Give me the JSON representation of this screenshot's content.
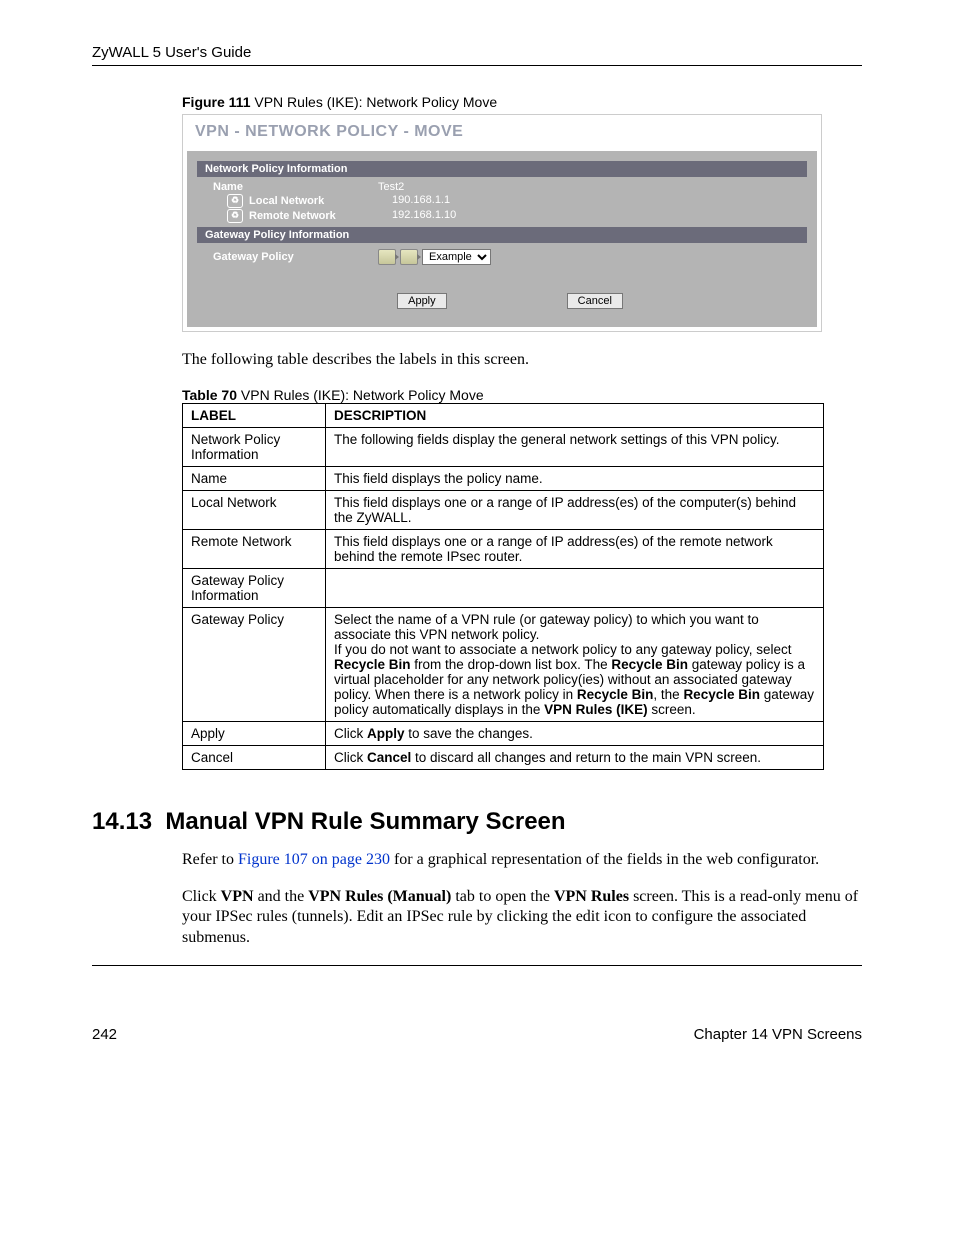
{
  "header": "ZyWALL 5 User's Guide",
  "figure_caption_bold": "Figure 111",
  "figure_caption_rest": "   VPN Rules (IKE): Network Policy Move",
  "panel": {
    "title": "VPN - NETWORK POLICY - MOVE",
    "band1": "Network Policy Information",
    "name_label": "Name",
    "name_value": "Test2",
    "local_label": "Local Network",
    "local_value": "190.168.1.1",
    "remote_label": "Remote Network",
    "remote_value": "192.168.1.10",
    "band2": "Gateway Policy Information",
    "gw_label": "Gateway Policy",
    "gw_select_value": "Example",
    "apply": "Apply",
    "cancel": "Cancel"
  },
  "intro_para": "The following table describes the labels in this screen.",
  "table_caption_bold": "Table 70",
  "table_caption_rest": "   VPN Rules (IKE): Network Policy Move",
  "th_label": "LABEL",
  "th_desc": "DESCRIPTION",
  "rows": [
    {
      "label": "Network Policy Information",
      "desc": "The following fields display the general network settings of this VPN policy."
    },
    {
      "label": "Name",
      "desc": "This field displays the policy name."
    },
    {
      "label": "Local Network",
      "desc": "This field displays one or a range of IP address(es) of the computer(s) behind the ZyWALL."
    },
    {
      "label": "Remote Network",
      "desc": "This field displays one or a range of IP address(es) of the remote network behind the remote IPsec router."
    },
    {
      "label": "Gateway Policy Information",
      "desc": ""
    },
    {
      "label": "Gateway Policy",
      "desc_html": "Select the name of a VPN rule (or gateway policy) to which you want to associate this VPN network policy.<br>If you do not want to associate a network policy to any gateway policy, select <b>Recycle Bin</b> from the drop-down list box. The <b>Recycle Bin</b> gateway policy is a virtual placeholder for any network policy(ies) without an associated gateway policy. When there is a network policy in <b>Recycle Bin</b>, the <b>Recycle Bin</b> gateway policy automatically displays in the <b>VPN Rules (IKE)</b> screen."
    },
    {
      "label": "Apply",
      "desc_html": "Click <b>Apply</b> to save the changes."
    },
    {
      "label": "Cancel",
      "desc_html": "Click <b>Cancel</b> to discard all changes and return to the main VPN screen."
    }
  ],
  "section_number": "14.13",
  "section_title": "Manual VPN Rule Summary Screen",
  "section_para1_pre": "Refer to ",
  "section_para1_link": "Figure 107 on page 230",
  "section_para1_post": " for a graphical representation of the fields in the web configurator.",
  "section_para2_html": "Click <b>VPN</b> and the <b>VPN Rules (Manual)</b> tab to open the <b>VPN Rules</b> screen. This is a read-only menu of your IPSec rules (tunnels). Edit an IPSec rule by clicking the edit icon to configure the associated submenus.",
  "page_number": "242",
  "chapter": "Chapter 14 VPN Screens"
}
